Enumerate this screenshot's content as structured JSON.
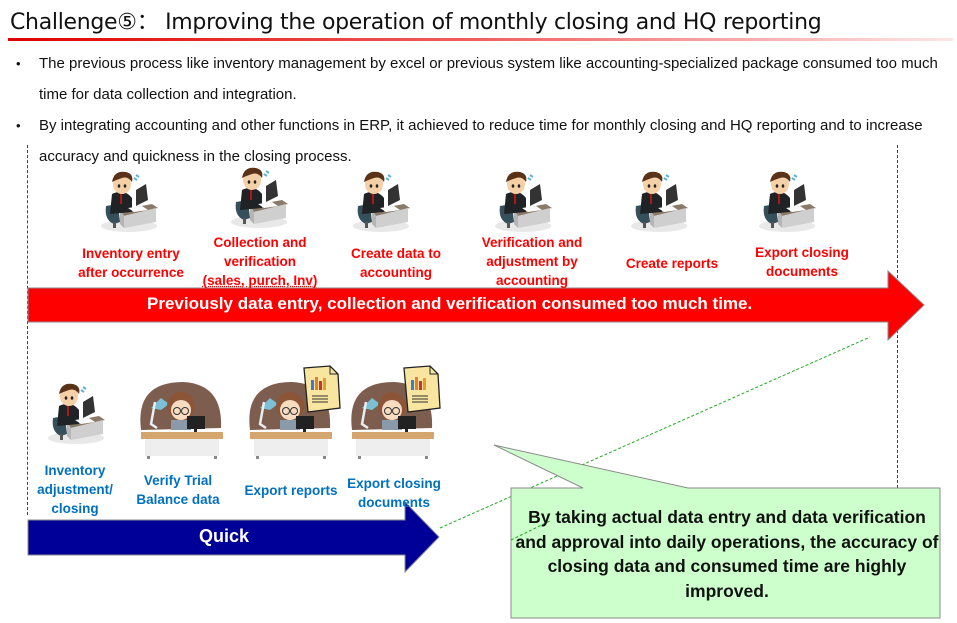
{
  "title": "Challenge⑤： Improving the operation of monthly closing and HQ reporting",
  "bullets": [
    "The previous process like inventory management by excel or previous system like accounting-specialized package consumed too much time for data collection and integration.",
    "By integrating accounting and other functions in ERP, it achieved to reduce time for monthly closing and HQ reporting and to increase accuracy and quickness in the closing process."
  ],
  "previous_flow": {
    "steps": [
      {
        "label": [
          "Inventory entry",
          "after occurrence"
        ],
        "icon": "stressed-office-worker-icon"
      },
      {
        "label": [
          "Collection and",
          "verification",
          "(sales, purch, Inv)"
        ],
        "icon": "stressed-office-worker-icon"
      },
      {
        "label": [
          "Create data to",
          "accounting"
        ],
        "icon": "stressed-office-worker-icon"
      },
      {
        "label": [
          "Verification and",
          "adjustment by",
          "accounting"
        ],
        "icon": "stressed-office-worker-icon"
      },
      {
        "label": [
          "Create reports"
        ],
        "icon": "stressed-office-worker-icon"
      },
      {
        "label": [
          "Export closing",
          "documents"
        ],
        "icon": "stressed-office-worker-icon"
      }
    ],
    "arrow_text": "Previously data entry, collection and verification consumed too much time.",
    "color": "#ff0000"
  },
  "new_flow": {
    "steps": [
      {
        "label": [
          "Inventory",
          "adjustment/",
          "closing"
        ],
        "icon": "office-worker-icon"
      },
      {
        "label": [
          "Verify Trial",
          "Balance data"
        ],
        "icon": "happy-worker-at-desk-icon"
      },
      {
        "label": [
          "Export reports"
        ],
        "icon": "happy-worker-with-report-icon"
      },
      {
        "label": [
          "Export closing",
          "documents"
        ],
        "icon": "happy-worker-with-report-icon"
      }
    ],
    "arrow_text": "Quick",
    "color": "#000099"
  },
  "callout": {
    "text": "By taking actual data entry and data verification and approval into daily operations, the accuracy of closing data and consumed time are highly improved.",
    "fill": "#ccffcc"
  }
}
